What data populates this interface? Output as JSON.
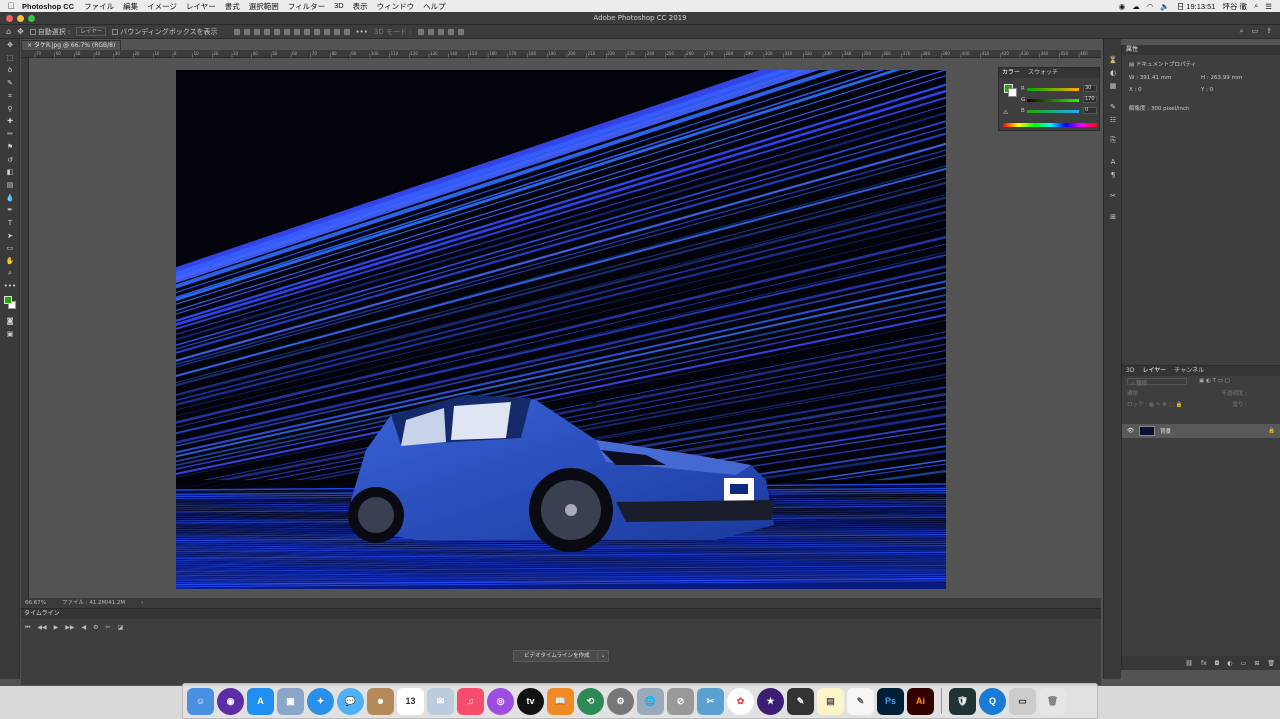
{
  "menubar": {
    "app_name": "Photoshop CC",
    "items": [
      "ファイル",
      "編集",
      "イメージ",
      "レイヤー",
      "書式",
      "選択範囲",
      "フィルター",
      "3D",
      "表示",
      "ウィンドウ",
      "ヘルプ"
    ],
    "clock": "日 19:13:51",
    "user": "坪谷 徹"
  },
  "window_title": "Adobe Photoshop CC 2019",
  "options_bar": {
    "auto_select_label": "自動選択 :",
    "auto_select_value": "レイヤー",
    "bounding_box_label": "バウンディングボックスを表示",
    "mode_label": "3D モード :"
  },
  "document": {
    "tab_label": "タケR.jpg @ 66.7% (RGB/8)",
    "zoom": "66.67%",
    "file_info": "ファイル : 41.2M/41.2M",
    "ruler_ticks": [
      "70",
      "60",
      "50",
      "40",
      "30",
      "20",
      "10",
      "0",
      "10",
      "20",
      "30",
      "40",
      "50",
      "60",
      "70",
      "80",
      "90",
      "100",
      "110",
      "120",
      "130",
      "140",
      "150",
      "160",
      "170",
      "180",
      "190",
      "200",
      "210",
      "220",
      "230",
      "240",
      "250",
      "260",
      "270",
      "280",
      "290",
      "300",
      "310",
      "320",
      "330",
      "340",
      "350",
      "360",
      "370",
      "380",
      "390",
      "400",
      "410",
      "420",
      "430",
      "440",
      "450",
      "460"
    ]
  },
  "timeline": {
    "title": "タイムライン",
    "create_button": "ビデオタイムラインを作成"
  },
  "color_panel": {
    "tabs": [
      "カラー",
      "スウォッチ"
    ],
    "channels": [
      {
        "label": "R",
        "value": "30"
      },
      {
        "label": "G",
        "value": "170"
      },
      {
        "label": "B",
        "value": "0"
      }
    ],
    "foreground_color": "#1eaa00"
  },
  "properties_panel": {
    "title": "属性",
    "subtitle": "ドキュメントプロパティ",
    "width": "W : 391.41 mm",
    "height": "H : 263.99 mm",
    "x": "X : 0",
    "y": "Y : 0",
    "resolution": "解像度 : 300 pixel/inch"
  },
  "layers_panel": {
    "tabs": [
      "3D",
      "レイヤー",
      "チャンネル"
    ],
    "search_placeholder": "種類",
    "blend_mode": "通常",
    "opacity_label": "不透明度 :",
    "lock_label": "ロック :",
    "fill_label": "塗り :",
    "layer_name": "背景"
  },
  "dock": {
    "ps_label": "Ps",
    "ai_label": "Ai",
    "calendar_day": "13"
  }
}
